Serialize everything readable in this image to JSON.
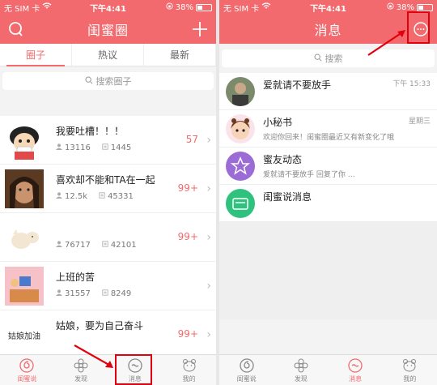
{
  "status": {
    "carrier": "无 SIM 卡",
    "time": "下午4:41",
    "battery": "38%"
  },
  "left": {
    "title": "闺蜜圈",
    "tabs": [
      {
        "label": "圈子",
        "active": true
      },
      {
        "label": "热议",
        "active": false
      },
      {
        "label": "最新",
        "active": false
      }
    ],
    "search_placeholder": "搜索圈子",
    "items": [
      {
        "title": "我要吐槽！！！",
        "stat1": "13116",
        "stat2": "1445",
        "badge": "57"
      },
      {
        "title": "喜欢却不能和TA在一起",
        "stat1": "12.5k",
        "stat2": "45331",
        "badge": "99+"
      },
      {
        "title": "",
        "stat1": "76717",
        "stat2": "42101",
        "badge": "99+"
      },
      {
        "title": "上班的苦",
        "stat1": "31557",
        "stat2": "8249",
        "badge": ""
      },
      {
        "title": "姑娘，要为自己奋斗",
        "stat1": "",
        "stat2": "",
        "badge": "99+",
        "avatar_text": "姑娘加油"
      }
    ]
  },
  "right": {
    "title": "消息",
    "search_placeholder": "搜索",
    "messages": [
      {
        "title": "爱就请不要放手",
        "preview": "",
        "time": "下午 15:33"
      },
      {
        "title": "小秘书",
        "preview": "欢迎你回来！闺蜜圈最近又有新变化了哦",
        "time": "星期三"
      },
      {
        "title": "蜜友动态",
        "preview": "爱就请不要放手 回复了你 …",
        "time": ""
      },
      {
        "title": "闺蜜说消息",
        "preview": "",
        "time": ""
      }
    ]
  },
  "tabbar": [
    {
      "label": "闺蜜说",
      "icon": "spiral-icon"
    },
    {
      "label": "发现",
      "icon": "flower-icon"
    },
    {
      "label": "消息",
      "icon": "chat-bubble-icon"
    },
    {
      "label": "我的",
      "icon": "bear-face-icon"
    }
  ],
  "colors": {
    "brand": "#f26a6d",
    "highlight_box": "#e1000d",
    "dynamic_avatar": "#9b6bd6",
    "system_avatar": "#2ec27e"
  }
}
